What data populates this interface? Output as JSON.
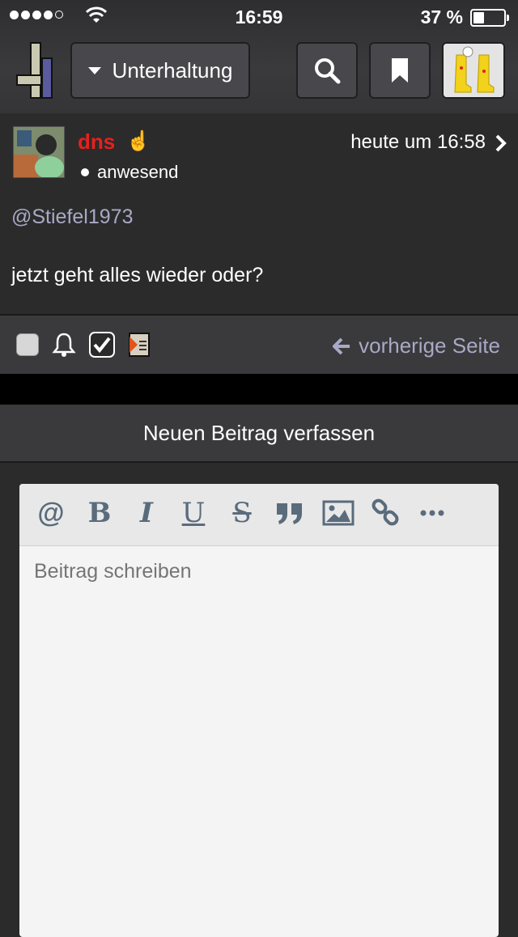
{
  "status_bar": {
    "time": "16:59",
    "battery": "37 %",
    "signal_bars": 4,
    "signal_total": 5,
    "battery_level": 0.37
  },
  "nav": {
    "forum_label": "Unterhaltung"
  },
  "post": {
    "username": "dns",
    "user_badge": "☝",
    "presence": "anwesend",
    "timestamp": "heute um 16:58",
    "mention": "@Stiefel1973",
    "message": "jetzt geht alles wieder oder?"
  },
  "actions": {
    "previous_page": "vorherige Seite"
  },
  "compose": {
    "title": "Neuen Beitrag verfassen",
    "placeholder": "Beitrag schreiben",
    "toolbar": {
      "mention": "@",
      "bold": "B",
      "italic": "I",
      "underline": "U",
      "strike": "S"
    }
  },
  "colors": {
    "accent_link": "#a9a8c6",
    "username": "#e8201c",
    "toolbar_icon": "#5a6b7c"
  },
  "icons": [
    "search-icon",
    "bookmark-icon",
    "bell-icon",
    "checkbox-icon",
    "document-icon",
    "arrow-left-icon",
    "quote-icon",
    "image-icon",
    "link-icon",
    "more-icon",
    "chevron-right-icon"
  ]
}
